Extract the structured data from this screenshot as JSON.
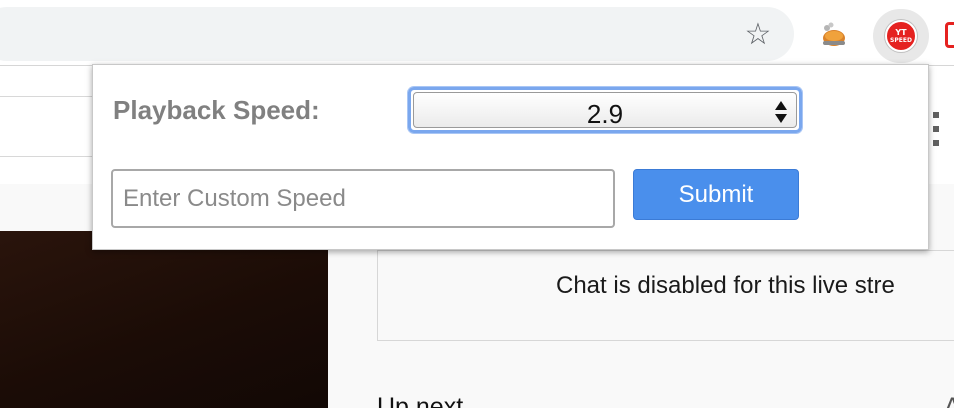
{
  "toolbar": {
    "icons": [
      "star-icon",
      "chicken-extension-icon",
      "yt-speed-extension-icon"
    ],
    "yt_speed_badge_line1": "YT",
    "yt_speed_badge_line2": "SPEED"
  },
  "popup": {
    "speed_label": "Playback Speed:",
    "speed_value": "2.9",
    "custom_input_placeholder": "Enter Custom Speed",
    "submit_label": "Submit",
    "colors": {
      "submit_bg": "#4a8fec",
      "focus_ring": "#7aa7ee",
      "label": "#808080"
    }
  },
  "page": {
    "chat_disabled_text": "Chat is disabled for this live stre",
    "up_next_label": "Up next",
    "up_next_right": "A"
  }
}
